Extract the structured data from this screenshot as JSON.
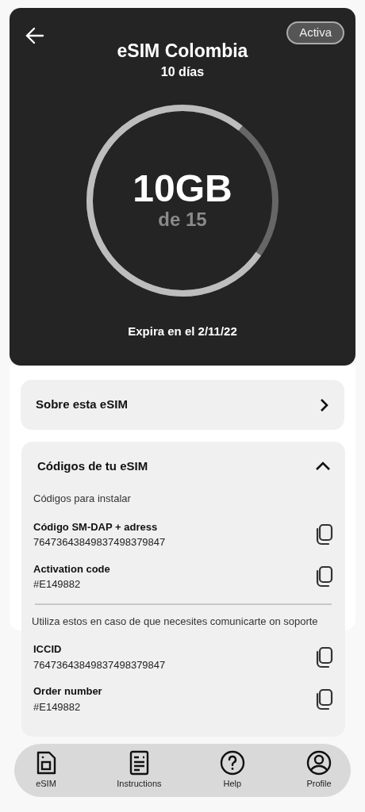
{
  "header": {
    "status": "Activa",
    "title": "eSIM Colombia",
    "duration": "10 días",
    "usage": {
      "amount": "10GB",
      "total": "de 15",
      "level": 0.76
    },
    "expiry": "Expira en el 2/11/22"
  },
  "about": {
    "label": "Sobre esta eSIM",
    "expanded": false
  },
  "codes": {
    "title": "Códigos de tu eSIM",
    "expanded": true,
    "groups": [
      {
        "caption": "Códigos para instalar",
        "items": [
          {
            "label": "Código SM-DAP + adress",
            "value": "76473643849837498379847"
          },
          {
            "label": "Activation code",
            "value": "#E149882"
          }
        ]
      },
      {
        "caption": "Utiliza estos en caso de que necesites comunicarte on soporte",
        "items": [
          {
            "label": "ICCID",
            "value": "76473643849837498379847"
          },
          {
            "label": "Order number",
            "value": "#E149882"
          }
        ]
      }
    ]
  },
  "nav": [
    {
      "kind": "sim",
      "label": "eSIM"
    },
    {
      "kind": "doc",
      "label": "Instructions"
    },
    {
      "kind": "help",
      "label": "Help"
    },
    {
      "kind": "profile",
      "label": "Profile"
    }
  ]
}
